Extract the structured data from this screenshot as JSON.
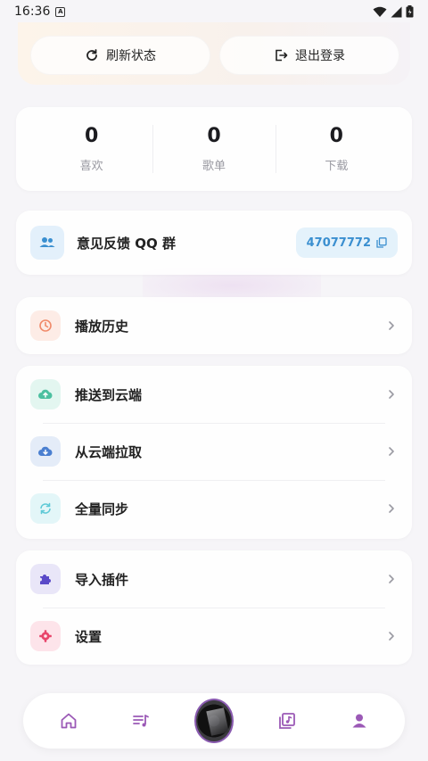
{
  "status_bar": {
    "time": "16:36",
    "app_glyph": "A"
  },
  "actions": {
    "refresh_label": "刷新状态",
    "logout_label": "退出登录"
  },
  "stats": [
    {
      "value": "0",
      "label": "喜欢"
    },
    {
      "value": "0",
      "label": "歌单"
    },
    {
      "value": "0",
      "label": "下载"
    }
  ],
  "feedback": {
    "title": "意见反馈 QQ 群",
    "qq_number": "47077772"
  },
  "menu": {
    "history": {
      "label": "播放历史",
      "icon": "history-icon",
      "color": "#f08a6a"
    },
    "push_cloud": {
      "label": "推送到云端",
      "icon": "cloud-upload-icon",
      "color": "#4cc0a0"
    },
    "pull_cloud": {
      "label": "从云端拉取",
      "icon": "cloud-download-icon",
      "color": "#4a7fd0"
    },
    "full_sync": {
      "label": "全量同步",
      "icon": "sync-icon",
      "color": "#5ec9d6"
    },
    "import_plugin": {
      "label": "导入插件",
      "icon": "puzzle-icon",
      "color": "#5a4ac8"
    },
    "settings": {
      "label": "设置",
      "icon": "gear-icon",
      "color": "#e8456a"
    }
  },
  "colors": {
    "accent": "#9b59b6",
    "background": "#f6f5f8"
  }
}
